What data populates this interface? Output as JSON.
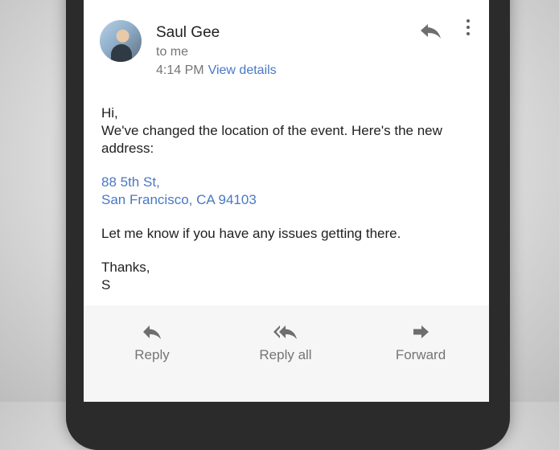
{
  "email": {
    "sender_name": "Saul Gee",
    "recipient_line": "to me",
    "time": "4:14 PM",
    "view_details_label": "View details",
    "body": {
      "greeting": "Hi,",
      "paragraph_1": "We've changed the location of the event. Here's the new address:",
      "address_line_1": "88 5th St,",
      "address_line_2": "San Francisco, CA 94103",
      "paragraph_2": "Let me know if you have any issues getting there.",
      "signoff": "Thanks,",
      "signature": "S"
    }
  },
  "header_icons": {
    "reply": "reply-icon",
    "more": "more-vert-icon"
  },
  "actions": [
    {
      "label": "Reply",
      "icon": "reply-icon"
    },
    {
      "label": "Reply all",
      "icon": "reply-all-icon"
    },
    {
      "label": "Forward",
      "icon": "forward-icon"
    }
  ],
  "colors": {
    "link": "#4a78c2",
    "secondary_text": "#757575",
    "primary_text": "#212121"
  }
}
